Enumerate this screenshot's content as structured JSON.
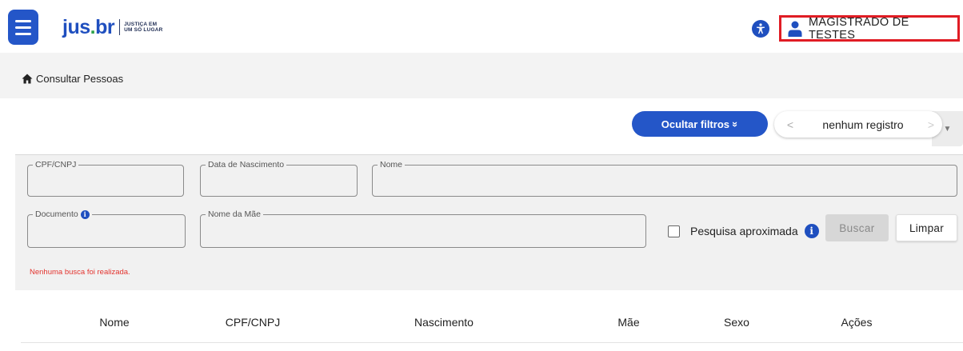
{
  "header": {
    "logo": {
      "jus": "jus",
      "dot": ".",
      "br": "br",
      "tagline_1": "JUSTIÇA EM",
      "tagline_2": "UM SÓ LUGAR"
    },
    "user_name": "MAGISTRADO DE TESTES"
  },
  "breadcrumb": {
    "label": "Consultar Pessoas"
  },
  "toolbar": {
    "hide_filters_label": "Ocultar filtros",
    "hide_filters_glyph": "»",
    "pager_prev": "<",
    "pager_count": "nenhum registro",
    "pager_next": ">"
  },
  "filters": {
    "cpf_label": "CPF/CNPJ",
    "birth_label": "Data de Nascimento",
    "name_label": "Nome",
    "document_label": "Documento",
    "mother_label": "Nome da Mãe",
    "approx_label": "Pesquisa aproximada",
    "search_button": "Buscar",
    "clear_button": "Limpar",
    "status_message": "Nenhuma busca foi realizada."
  },
  "table": {
    "columns": [
      "Nome",
      "CPF/CNPJ",
      "Nascimento",
      "Mãe",
      "Sexo",
      "Ações"
    ]
  },
  "colors": {
    "primary": "#2456c8",
    "highlight_border": "#e01c24",
    "error_text": "#e3342f"
  }
}
